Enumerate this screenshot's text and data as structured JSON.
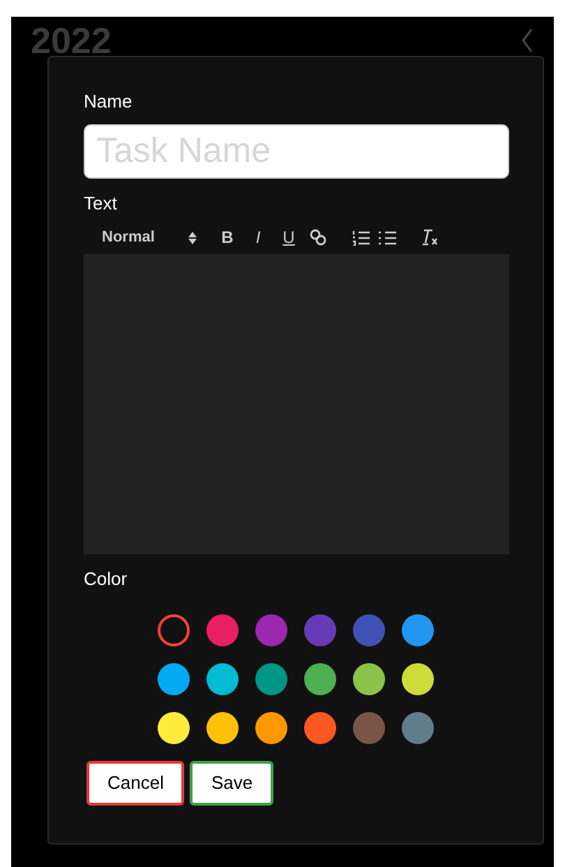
{
  "background": {
    "heading": "2022"
  },
  "dialog": {
    "name_label": "Name",
    "name_field": {
      "placeholder": "Task Name"
    },
    "text_label": "Text",
    "toolbar": {
      "format": "Normal",
      "buttons": [
        {
          "kind": "bold",
          "label": "B"
        },
        {
          "kind": "italic",
          "label": "I"
        },
        {
          "kind": "underline",
          "label": "U"
        },
        {
          "kind": "link"
        },
        {
          "kind": "ordered"
        },
        {
          "kind": "bullet"
        },
        {
          "kind": "clean"
        }
      ]
    },
    "color_label": "Color",
    "colors": [
      {
        "color": "#f44336",
        "selected": true
      },
      {
        "color": "#e91e63",
        "selected": false
      },
      {
        "color": "#9c27b0",
        "selected": false
      },
      {
        "color": "#673ab7",
        "selected": false
      },
      {
        "color": "#3f51b5",
        "selected": false
      },
      {
        "color": "#2196f3",
        "selected": false
      },
      {
        "color": "#03a9f4",
        "selected": false
      },
      {
        "color": "#00bcd4",
        "selected": false
      },
      {
        "color": "#009688",
        "selected": false
      },
      {
        "color": "#4caf50",
        "selected": false
      },
      {
        "color": "#8bc34a",
        "selected": false
      },
      {
        "color": "#cddc39",
        "selected": false
      },
      {
        "color": "#ffeb3b",
        "selected": false
      },
      {
        "color": "#ffc107",
        "selected": false
      },
      {
        "color": "#ff9800",
        "selected": false
      },
      {
        "color": "#ff5722",
        "selected": false
      },
      {
        "color": "#795548",
        "selected": false
      },
      {
        "color": "#607d8b",
        "selected": false
      }
    ],
    "buttons": [
      {
        "kind": "cancel",
        "label": "Cancel"
      },
      {
        "kind": "save",
        "label": "Save"
      }
    ]
  }
}
